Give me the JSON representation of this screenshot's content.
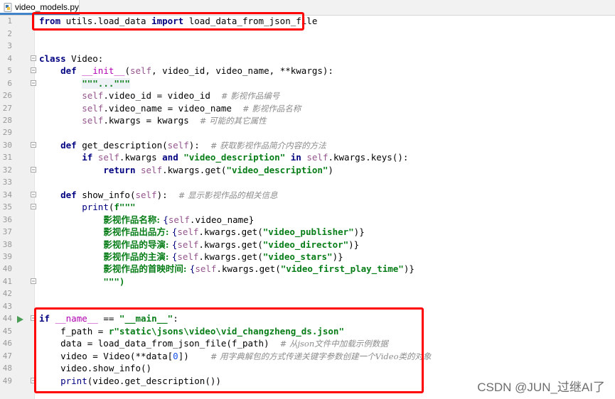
{
  "tab": {
    "filename": "video_models.py"
  },
  "line_numbers": [
    "1",
    "2",
    "3",
    "4",
    "5",
    "6",
    "26",
    "27",
    "28",
    "29",
    "30",
    "31",
    "32",
    "33",
    "34",
    "35",
    "36",
    "37",
    "38",
    "39",
    "40",
    "41",
    "42",
    "43",
    "44",
    "45",
    "46",
    "47",
    "48",
    "49"
  ],
  "code": {
    "l1": [
      "from",
      " utils.load_data ",
      "import",
      " load_data_from_json_file"
    ],
    "l4": [
      "class",
      " Video:"
    ],
    "l5": [
      "    ",
      "def",
      " ",
      "__init__",
      "(",
      "self",
      ", video_id, video_name, **kwargs):"
    ],
    "l6": [
      "        ",
      "\"\"\"...\"\"\""
    ],
    "l26": [
      "        ",
      "self",
      ".video_id = video_id  ",
      "# 影视作品编号"
    ],
    "l27": [
      "        ",
      "self",
      ".video_name = video_name  ",
      "# 影视作品名称"
    ],
    "l28": [
      "        ",
      "self",
      ".kwargs = kwargs  ",
      "# 可能的其它属性"
    ],
    "l30": [
      "    ",
      "def",
      " get_description(",
      "self",
      "):  ",
      "# 获取影视作品简介内容的方法"
    ],
    "l31": [
      "        ",
      "if",
      " ",
      "self",
      ".kwargs ",
      "and",
      " ",
      "\"video_description\"",
      " ",
      "in",
      " ",
      "self",
      ".kwargs.keys():"
    ],
    "l32": [
      "            ",
      "return",
      " ",
      "self",
      ".kwargs.get(",
      "\"video_description\"",
      ")"
    ],
    "l34": [
      "    ",
      "def",
      " show_info(",
      "self",
      "):  ",
      "# 显示影视作品的相关信息"
    ],
    "l35": [
      "        ",
      "print",
      "(",
      "f\"\"\""
    ],
    "l36": [
      "            ",
      "影视作品名称: ",
      "{",
      "self",
      ".video_name}"
    ],
    "l37": [
      "            ",
      "影视作品出品方: ",
      "{",
      "self",
      ".kwargs.get(",
      "\"video_publisher\"",
      ")}"
    ],
    "l38": [
      "            ",
      "影视作品的导演: ",
      "{",
      "self",
      ".kwargs.get(",
      "\"video_director\"",
      ")}"
    ],
    "l39": [
      "            ",
      "影视作品的主演: ",
      "{",
      "self",
      ".kwargs.get(",
      "\"video_stars\"",
      ")}"
    ],
    "l40": [
      "            ",
      "影视作品的首映时间: ",
      "{",
      "self",
      ".kwargs.get(",
      "\"video_first_play_time\"",
      ")}"
    ],
    "l41": [
      "            ",
      "\"\"\")"
    ],
    "l44": [
      "if",
      " ",
      "__name__",
      " == ",
      "\"__main__\"",
      ":"
    ],
    "l45": [
      "    f_path = ",
      "r\"static\\jsons\\video\\vid_changzheng_ds.json\""
    ],
    "l46": [
      "    data = load_data_from_json_file(f_path)  ",
      "# 从json文件中加载示例数据"
    ],
    "l47": [
      "    video = Video(**data[",
      "0",
      "])    ",
      "# 用字典解包的方式传递关键字参数创建一个Video类的对象"
    ],
    "l48": [
      "    video.show_info()"
    ],
    "l49": [
      "    ",
      "print",
      "(video.get_description())"
    ]
  },
  "watermark": "CSDN @JUN_过继AI了",
  "colors": {
    "highlight": "#ff0000",
    "keyword": "#000080",
    "string": "#067d17",
    "self": "#94558d",
    "comment": "#8c8c8c"
  }
}
